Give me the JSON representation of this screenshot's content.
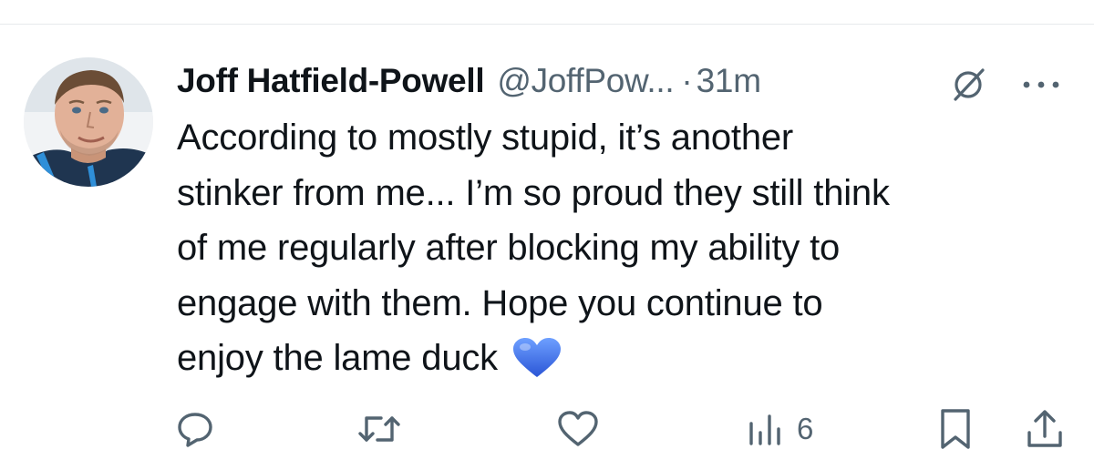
{
  "tweet": {
    "author_name": "Joff Hatfield-Powell",
    "author_handle": "@JoffPow...",
    "separator": "·",
    "time": "31m",
    "text_lines": [
      "According to mostly stupid, it’s another",
      "stinker from me... I’m so proud they still think",
      "of me regularly after blocking my ability to",
      "engage with them. Hope you continue to",
      "enjoy the lame duck"
    ],
    "emoji": "blue-heart"
  },
  "actions": {
    "views_count": "6"
  },
  "icons": {
    "reply": "reply-icon",
    "retweet": "retweet-icon",
    "like": "heart-outline-icon",
    "views": "views-bar-chart-icon",
    "bookmark": "bookmark-icon",
    "share": "share-icon",
    "grok": "grok-icon",
    "more": "more-dots-icon"
  },
  "colors": {
    "text_primary": "#0f1419",
    "text_secondary": "#536471",
    "heart_emoji": "#3b6ff0"
  }
}
